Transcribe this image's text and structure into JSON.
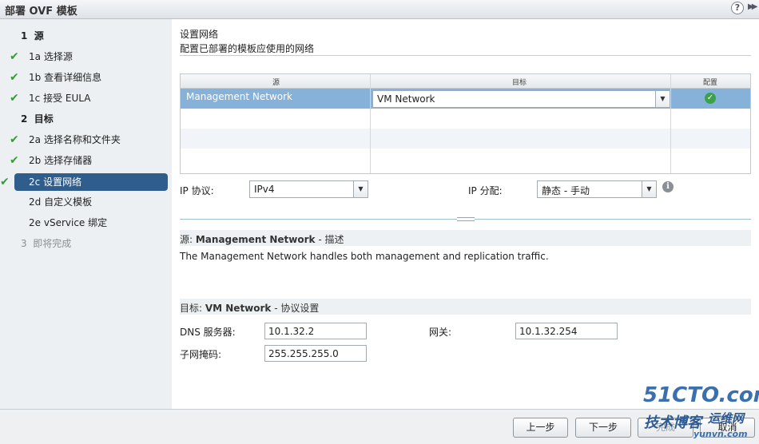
{
  "window": {
    "title": "部署 OVF 模板",
    "help_label": "?",
    "expand_label": "▶▶"
  },
  "steps": [
    {
      "num": "1",
      "label": "源",
      "state": "head"
    },
    {
      "num": "1a",
      "label": "选择源",
      "state": "done"
    },
    {
      "num": "1b",
      "label": "查看详细信息",
      "state": "done"
    },
    {
      "num": "1c",
      "label": "接受 EULA",
      "state": "done"
    },
    {
      "num": "2",
      "label": "目标",
      "state": "head"
    },
    {
      "num": "2a",
      "label": "选择名称和文件夹",
      "state": "done"
    },
    {
      "num": "2b",
      "label": "选择存储器",
      "state": "done"
    },
    {
      "num": "2c",
      "label": "设置网络",
      "state": "current"
    },
    {
      "num": "2d",
      "label": "自定义模板",
      "state": "pending"
    },
    {
      "num": "2e",
      "label": "vService 绑定",
      "state": "pending"
    },
    {
      "num": "3",
      "label": "即将完成",
      "state": "disabled"
    }
  ],
  "check_glyph": "✔",
  "page": {
    "title": "设置网络",
    "subtitle": "配置已部署的模板应使用的网络"
  },
  "grid": {
    "columns": [
      "源",
      "目标",
      "配置"
    ],
    "rows": [
      {
        "source": "Management Network",
        "destination": "VM Network",
        "configured": true
      }
    ]
  },
  "ip": {
    "protocol_label": "IP 协议:",
    "protocol_value": "IPv4",
    "allocation_label": "IP 分配:",
    "allocation_value": "静态 - 手动",
    "info_glyph": "i"
  },
  "source_section": {
    "prefix": "源: ",
    "name": "Management Network",
    "suffix": " - 描述",
    "description": "The Management Network handles both management and replication traffic."
  },
  "dest_section": {
    "prefix": "目标: ",
    "name": "VM Network",
    "suffix": " - 协议设置",
    "dns_label": "DNS 服务器:",
    "dns_value": "10.1.32.2",
    "gateway_label": "网关:",
    "gateway_value": "10.1.32.254",
    "netmask_label": "子网掩码:",
    "netmask_value": "255.255.255.0"
  },
  "footer": {
    "back_label": "上一步",
    "next_label": "下一步",
    "finish_label": "完成",
    "cancel_label": "取消"
  },
  "watermark": {
    "line1": "51CTO.com",
    "line2": "技术博客",
    "line3": "运维网",
    "line4": "yunvn.com"
  },
  "colors": {
    "selected_step": "#2f5d8c",
    "selected_row": "#86b1d9",
    "check": "#3a9a3a",
    "ok": "#3ca24a"
  }
}
